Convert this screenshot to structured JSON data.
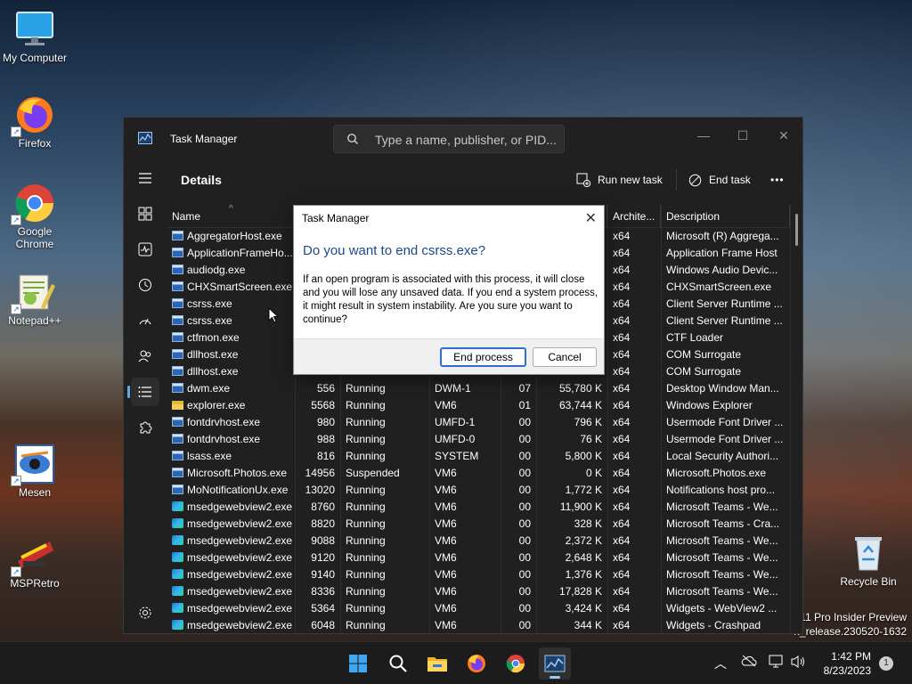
{
  "desktop": {
    "icons": [
      {
        "label": "My Computer",
        "icon": "monitor-icon"
      },
      {
        "label": "Firefox",
        "icon": "firefox-icon"
      },
      {
        "label": "Google Chrome",
        "icon": "chrome-icon"
      },
      {
        "label": "Notepad++",
        "icon": "notepadpp-icon"
      },
      {
        "label": "Mesen",
        "icon": "mesen-icon"
      },
      {
        "label": "MSPRetro",
        "icon": "mspretro-icon"
      },
      {
        "label": "Recycle Bin",
        "icon": "recycle-bin-icon"
      }
    ],
    "watermark_line1": "11 Pro Insider Preview",
    "watermark_line2": "n_release.230520-1632"
  },
  "taskmanager": {
    "title": "Task Manager",
    "search_placeholder": "Type a name, publisher, or PID...",
    "page_title": "Details",
    "run_new_task": "Run new task",
    "end_task": "End task",
    "more": "•••",
    "columns": {
      "name": "Name",
      "pid": "",
      "status": "",
      "user": "",
      "cpu": "",
      "memory": "",
      "arch": "Archite...",
      "description": "Description"
    },
    "rows": [
      {
        "icon": "app",
        "name": "AggregatorHost.exe",
        "pid": "",
        "status": "",
        "user": "",
        "cpu": "",
        "mem": "",
        "arch": "x64",
        "desc": "Microsoft (R) Aggrega..."
      },
      {
        "icon": "app",
        "name": "ApplicationFrameHo...",
        "pid": "",
        "status": "",
        "user": "",
        "cpu": "",
        "mem": "",
        "arch": "x64",
        "desc": "Application Frame Host"
      },
      {
        "icon": "app",
        "name": "audiodg.exe",
        "pid": "",
        "status": "",
        "user": "",
        "cpu": "",
        "mem": "",
        "arch": "x64",
        "desc": "Windows Audio Devic..."
      },
      {
        "icon": "app",
        "name": "CHXSmartScreen.exe",
        "pid": "",
        "status": "",
        "user": "",
        "cpu": "",
        "mem": "",
        "arch": "x64",
        "desc": "CHXSmartScreen.exe"
      },
      {
        "icon": "app",
        "name": "csrss.exe",
        "pid": "",
        "status": "",
        "user": "",
        "cpu": "",
        "mem": "",
        "arch": "x64",
        "desc": "Client Server Runtime ..."
      },
      {
        "icon": "app",
        "name": "csrss.exe",
        "pid": "",
        "status": "",
        "user": "",
        "cpu": "",
        "mem": "",
        "arch": "x64",
        "desc": "Client Server Runtime ..."
      },
      {
        "icon": "app",
        "name": "ctfmon.exe",
        "pid": "",
        "status": "",
        "user": "",
        "cpu": "",
        "mem": "",
        "arch": "x64",
        "desc": "CTF Loader"
      },
      {
        "icon": "app",
        "name": "dllhost.exe",
        "pid": "",
        "status": "",
        "user": "",
        "cpu": "",
        "mem": "",
        "arch": "x64",
        "desc": "COM Surrogate"
      },
      {
        "icon": "app",
        "name": "dllhost.exe",
        "pid": "",
        "status": "",
        "user": "",
        "cpu": "",
        "mem": "",
        "arch": "x64",
        "desc": "COM Surrogate"
      },
      {
        "icon": "app",
        "name": "dwm.exe",
        "pid": "556",
        "status": "Running",
        "user": "DWM-1",
        "cpu": "07",
        "mem": "55,780 K",
        "arch": "x64",
        "desc": "Desktop Window Man..."
      },
      {
        "icon": "folder",
        "name": "explorer.exe",
        "pid": "5568",
        "status": "Running",
        "user": "VM6",
        "cpu": "01",
        "mem": "63,744 K",
        "arch": "x64",
        "desc": "Windows Explorer"
      },
      {
        "icon": "app",
        "name": "fontdrvhost.exe",
        "pid": "980",
        "status": "Running",
        "user": "UMFD-1",
        "cpu": "00",
        "mem": "796 K",
        "arch": "x64",
        "desc": "Usermode Font Driver ..."
      },
      {
        "icon": "app",
        "name": "fontdrvhost.exe",
        "pid": "988",
        "status": "Running",
        "user": "UMFD-0",
        "cpu": "00",
        "mem": "76 K",
        "arch": "x64",
        "desc": "Usermode Font Driver ..."
      },
      {
        "icon": "app",
        "name": "lsass.exe",
        "pid": "816",
        "status": "Running",
        "user": "SYSTEM",
        "cpu": "00",
        "mem": "5,800 K",
        "arch": "x64",
        "desc": "Local Security Authori..."
      },
      {
        "icon": "app",
        "name": "Microsoft.Photos.exe",
        "pid": "14956",
        "status": "Suspended",
        "user": "VM6",
        "cpu": "00",
        "mem": "0 K",
        "arch": "x64",
        "desc": "Microsoft.Photos.exe"
      },
      {
        "icon": "app",
        "name": "MoNotificationUx.exe",
        "pid": "13020",
        "status": "Running",
        "user": "VM6",
        "cpu": "00",
        "mem": "1,772 K",
        "arch": "x64",
        "desc": "Notifications host pro..."
      },
      {
        "icon": "edge",
        "name": "msedgewebview2.exe",
        "pid": "8760",
        "status": "Running",
        "user": "VM6",
        "cpu": "00",
        "mem": "11,900 K",
        "arch": "x64",
        "desc": "Microsoft Teams - We..."
      },
      {
        "icon": "edge",
        "name": "msedgewebview2.exe",
        "pid": "8820",
        "status": "Running",
        "user": "VM6",
        "cpu": "00",
        "mem": "328 K",
        "arch": "x64",
        "desc": "Microsoft Teams - Cra..."
      },
      {
        "icon": "edge",
        "name": "msedgewebview2.exe",
        "pid": "9088",
        "status": "Running",
        "user": "VM6",
        "cpu": "00",
        "mem": "2,372 K",
        "arch": "x64",
        "desc": "Microsoft Teams - We..."
      },
      {
        "icon": "edge",
        "name": "msedgewebview2.exe",
        "pid": "9120",
        "status": "Running",
        "user": "VM6",
        "cpu": "00",
        "mem": "2,648 K",
        "arch": "x64",
        "desc": "Microsoft Teams - We..."
      },
      {
        "icon": "edge",
        "name": "msedgewebview2.exe",
        "pid": "9140",
        "status": "Running",
        "user": "VM6",
        "cpu": "00",
        "mem": "1,376 K",
        "arch": "x64",
        "desc": "Microsoft Teams - We..."
      },
      {
        "icon": "edge",
        "name": "msedgewebview2.exe",
        "pid": "8336",
        "status": "Running",
        "user": "VM6",
        "cpu": "00",
        "mem": "17,828 K",
        "arch": "x64",
        "desc": "Microsoft Teams - We..."
      },
      {
        "icon": "edge",
        "name": "msedgewebview2.exe",
        "pid": "5364",
        "status": "Running",
        "user": "VM6",
        "cpu": "00",
        "mem": "3,424 K",
        "arch": "x64",
        "desc": "Widgets - WebView2 ..."
      },
      {
        "icon": "edge",
        "name": "msedgewebview2.exe",
        "pid": "6048",
        "status": "Running",
        "user": "VM6",
        "cpu": "00",
        "mem": "344 K",
        "arch": "x64",
        "desc": "Widgets - Crashpad"
      }
    ]
  },
  "dialog": {
    "title": "Task Manager",
    "heading": "Do you want to end csrss.exe?",
    "message": "If an open program is associated with this process, it will close and you will lose any unsaved data. If you end a system process, it might result in system instability. Are you sure you want to continue?",
    "primary": "End process",
    "secondary": "Cancel"
  },
  "taskbar": {
    "apps": [
      "start-icon",
      "search-icon",
      "file-explorer-icon",
      "firefox-icon",
      "chrome-icon",
      "task-manager-icon"
    ],
    "time": "1:42 PM",
    "date": "8/23/2023",
    "notification_count": "1"
  }
}
